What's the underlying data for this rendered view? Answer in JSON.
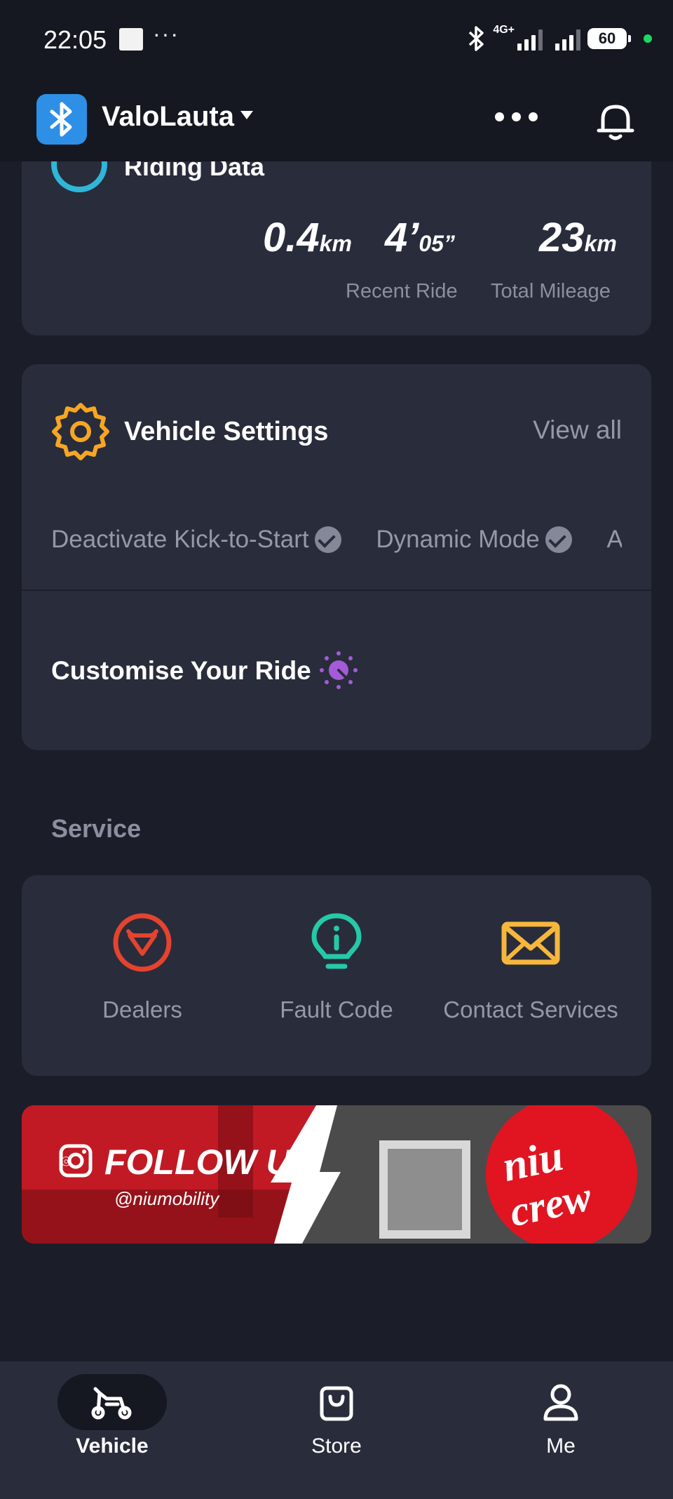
{
  "status_bar": {
    "time": "22:05",
    "overflow_dots": "···",
    "network": "4G+",
    "battery": "60"
  },
  "header": {
    "device_name": "ValoLauta"
  },
  "riding_data": {
    "title": "Riding Data",
    "recent_distance": "0.4",
    "recent_distance_unit": "km",
    "recent_time_min": "4’",
    "recent_time_sec": "05”",
    "recent_label": "Recent Ride",
    "total_mileage": "23",
    "total_mileage_unit": "km",
    "total_label": "Total Mileage"
  },
  "vehicle_settings": {
    "title": "Vehicle Settings",
    "view_all": "View all",
    "chips": [
      "Deactivate Kick-to-Start",
      "Dynamic Mode",
      "Auto"
    ],
    "customise": "Customise Your Ride"
  },
  "service": {
    "title": "Service",
    "items": [
      {
        "label": "Dealers",
        "icon": "dealer-icon",
        "color": "#e4432f"
      },
      {
        "label": "Fault Code",
        "icon": "bulb-icon",
        "color": "#25c9a8"
      },
      {
        "label": "Contact Services",
        "icon": "mail-icon",
        "color": "#f6b73c"
      }
    ]
  },
  "banner": {
    "follow": "FOLLOW US",
    "handle": "@niumobility",
    "brand_line1": "niu",
    "brand_line2": "crew"
  },
  "bottom_nav": {
    "vehicle": "Vehicle",
    "store": "Store",
    "me": "Me"
  },
  "colors": {
    "accent_blue": "#2e8fe6",
    "gear_orange": "#f6a623",
    "purple": "#a55ad8",
    "riding_cyan": "#2fb6d8"
  }
}
